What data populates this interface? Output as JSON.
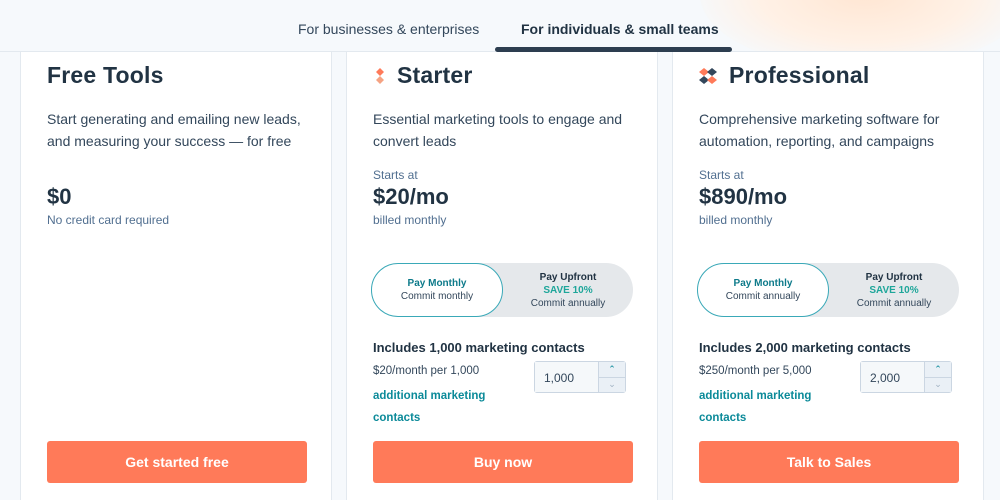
{
  "tabs": {
    "businesses": "For businesses & enterprises",
    "individuals": "For individuals & small teams"
  },
  "plans": [
    {
      "name": "Free Tools",
      "description": "Start generating and emailing new leads, and measuring your success — for free",
      "price": "$0",
      "price_note": "No credit card required",
      "cta": "Get started free"
    },
    {
      "name": "Starter",
      "icon": "sprocket-icon",
      "description": "Essential marketing tools to engage and convert leads",
      "starts_at": "Starts at",
      "price": "$20/mo",
      "price_note": "billed monthly",
      "toggle": {
        "monthly_title": "Pay Monthly",
        "monthly_sub": "Commit monthly",
        "upfront_title": "Pay Upfront",
        "upfront_save": "SAVE 10%",
        "upfront_sub": "Commit annually"
      },
      "contacts_title": "Includes 1,000 marketing contacts",
      "per_line": "$20/month per 1,000",
      "add_link": "additional marketing contacts",
      "stepper_value": "1,000",
      "cta": "Buy now"
    },
    {
      "name": "Professional",
      "icon": "sprocket-pro-icon",
      "description": "Comprehensive marketing software for automation, reporting, and campaigns",
      "starts_at": "Starts at",
      "price": "$890/mo",
      "price_note": "billed monthly",
      "toggle": {
        "monthly_title": "Pay Monthly",
        "monthly_sub": "Commit annually",
        "upfront_title": "Pay Upfront",
        "upfront_save": "SAVE 10%",
        "upfront_sub": "Commit annually"
      },
      "contacts_title": "Includes 2,000 marketing contacts",
      "per_line": "$250/month per 5,000",
      "add_link": "additional marketing contacts",
      "stepper_value": "2,000",
      "cta": "Talk to Sales"
    }
  ],
  "colors": {
    "accent": "#ff7a59",
    "teal": "#0b8a99",
    "heading": "#213343"
  }
}
